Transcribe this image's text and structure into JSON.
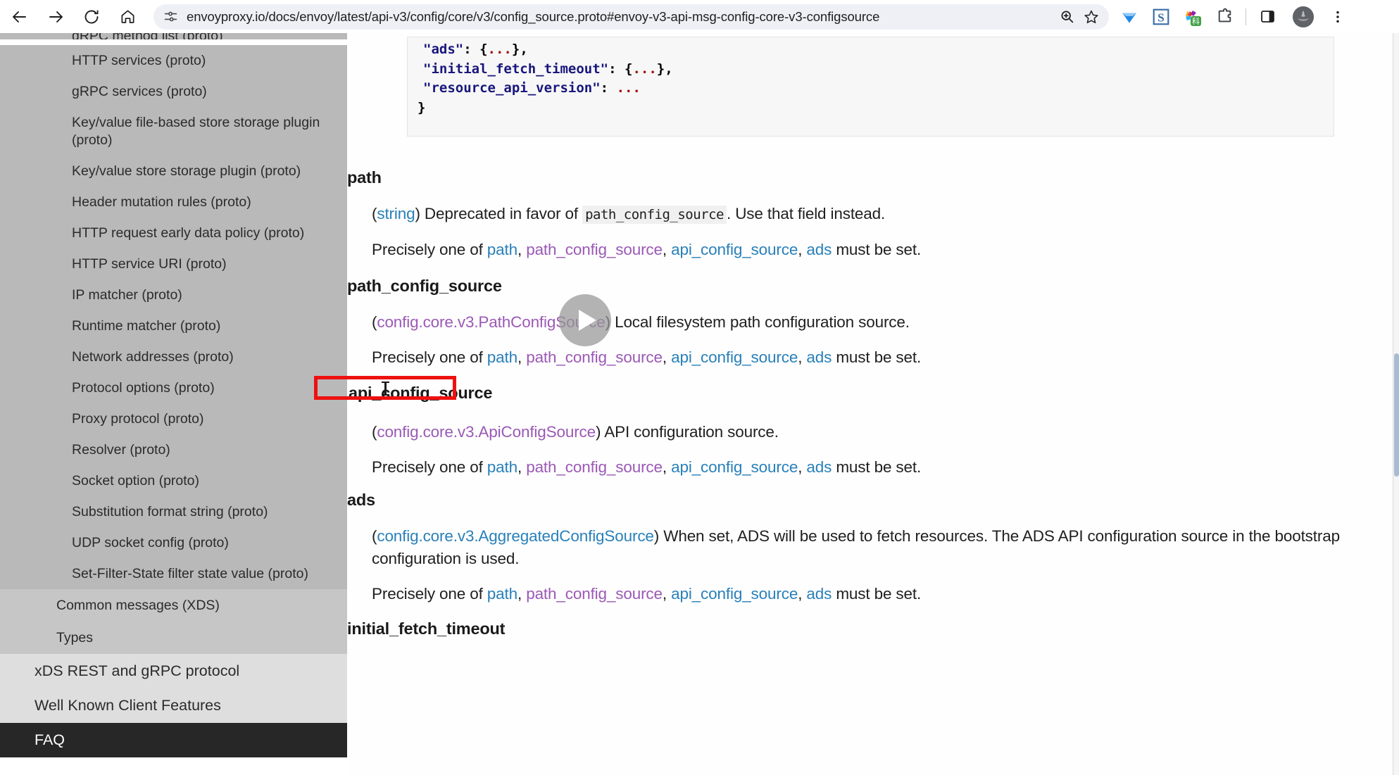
{
  "browser": {
    "url": "envoyproxy.io/docs/envoy/latest/api-v3/config/core/v3/config_source.proto#envoy-v3-api-msg-config-core-v3-configsource",
    "back_icon": "back-arrow-icon",
    "forward_icon": "forward-arrow-icon",
    "reload_icon": "reload-icon",
    "home_icon": "home-icon",
    "site_settings_icon": "tune-settings-icon",
    "omnibox_zoom_icon": "zoom-magnifier-icon",
    "bookmark_icon": "bookmark-star-icon",
    "extensions": [
      {
        "name": "diamond-extension-icon",
        "color": "#2d6fd8"
      },
      {
        "name": "s-extension-icon",
        "color": "#3b6fa8"
      },
      {
        "name": "translate-extension-icon",
        "color": "#4caf50",
        "badge": "科"
      },
      {
        "name": "puzzle-extensions-icon",
        "color": "#3c4043"
      }
    ],
    "side_panel_icon": "side-panel-icon",
    "profile_icon": "profile-avatar-icon",
    "menu_icon": "three-dot-menu-icon"
  },
  "sidebar": {
    "items": [
      {
        "label": "gRPC method list (proto)",
        "level": "deep",
        "truncated": true
      },
      {
        "label": "HTTP services (proto)",
        "level": "deep"
      },
      {
        "label": "gRPC services (proto)",
        "level": "deep"
      },
      {
        "label": "Key/value file-based store storage plugin (proto)",
        "level": "deep"
      },
      {
        "label": "Key/value store storage plugin (proto)",
        "level": "deep"
      },
      {
        "label": "Header mutation rules (proto)",
        "level": "deep"
      },
      {
        "label": "HTTP request early data policy (proto)",
        "level": "deep"
      },
      {
        "label": "HTTP service URI (proto)",
        "level": "deep"
      },
      {
        "label": "IP matcher (proto)",
        "level": "deep"
      },
      {
        "label": "Runtime matcher (proto)",
        "level": "deep"
      },
      {
        "label": "Network addresses (proto)",
        "level": "deep"
      },
      {
        "label": "Protocol options (proto)",
        "level": "deep"
      },
      {
        "label": "Proxy protocol (proto)",
        "level": "deep"
      },
      {
        "label": "Resolver (proto)",
        "level": "deep"
      },
      {
        "label": "Socket option (proto)",
        "level": "deep"
      },
      {
        "label": "Substitution format string (proto)",
        "level": "deep"
      },
      {
        "label": "UDP socket config (proto)",
        "level": "deep"
      },
      {
        "label": "Set-Filter-State filter state value (proto)",
        "level": "deep"
      },
      {
        "label": "Common messages (XDS)",
        "level": "mid"
      },
      {
        "label": "Types",
        "level": "mid"
      },
      {
        "label": "xDS REST and gRPC protocol",
        "level": "top"
      },
      {
        "label": "Well Known Client Features",
        "level": "top"
      },
      {
        "label": "FAQ",
        "level": "dark"
      }
    ]
  },
  "code_block": {
    "lines": [
      {
        "key": "\"ads\"",
        "value": "{...},",
        "indent": 2
      },
      {
        "key": "\"initial_fetch_timeout\"",
        "value": "{...},",
        "indent": 2
      },
      {
        "key": "\"resource_api_version\"",
        "value": "...",
        "indent": 2
      }
    ],
    "closing_brace": "}"
  },
  "content": {
    "fields": [
      {
        "name": "path",
        "type_link": "string",
        "type_link_color": "blue",
        "description_prefix": ") Deprecated in favor of ",
        "inline_code": "path_config_source",
        "description_suffix": ". Use that field instead.",
        "constraint": {
          "prefix": "Precisely one of ",
          "links": [
            "path",
            "path_config_source",
            "api_config_source",
            "ads"
          ],
          "suffix": " must be set."
        }
      },
      {
        "name": "path_config_source",
        "type_link": "config.core.v3.PathConfigSource",
        "type_link_color": "purple",
        "description_prefix": ") Local filesystem path configuration source.",
        "constraint": {
          "prefix": "Precisely one of ",
          "links": [
            "path",
            "path_config_source",
            "api_config_source",
            "ads"
          ],
          "suffix": " must be set."
        }
      },
      {
        "name": "api_config_source",
        "highlighted": true,
        "type_link": "config.core.v3.ApiConfigSource",
        "type_link_color": "purple",
        "description_prefix": ") API configuration source.",
        "constraint": {
          "prefix": "Precisely one of ",
          "links": [
            "path",
            "path_config_source",
            "api_config_source",
            "ads"
          ],
          "suffix": " must be set."
        }
      },
      {
        "name": "ads",
        "type_link": "config.core.v3.AggregatedConfigSource",
        "type_link_color": "blue",
        "description_prefix": ") When set, ADS will be used to fetch resources. The ADS API configuration source in the bootstrap configuration is used.",
        "constraint": {
          "prefix": "Precisely one of ",
          "links": [
            "path",
            "path_config_source",
            "api_config_source",
            "ads"
          ],
          "suffix": " must be set."
        }
      },
      {
        "name": "initial_fetch_timeout"
      }
    ],
    "link_colors": {
      "path": "blue",
      "path_config_source": "purple",
      "api_config_source": "blue",
      "ads": "blue"
    }
  },
  "overlay": {
    "play_button_label": "play-button",
    "highlight_color": "#ee1111"
  }
}
